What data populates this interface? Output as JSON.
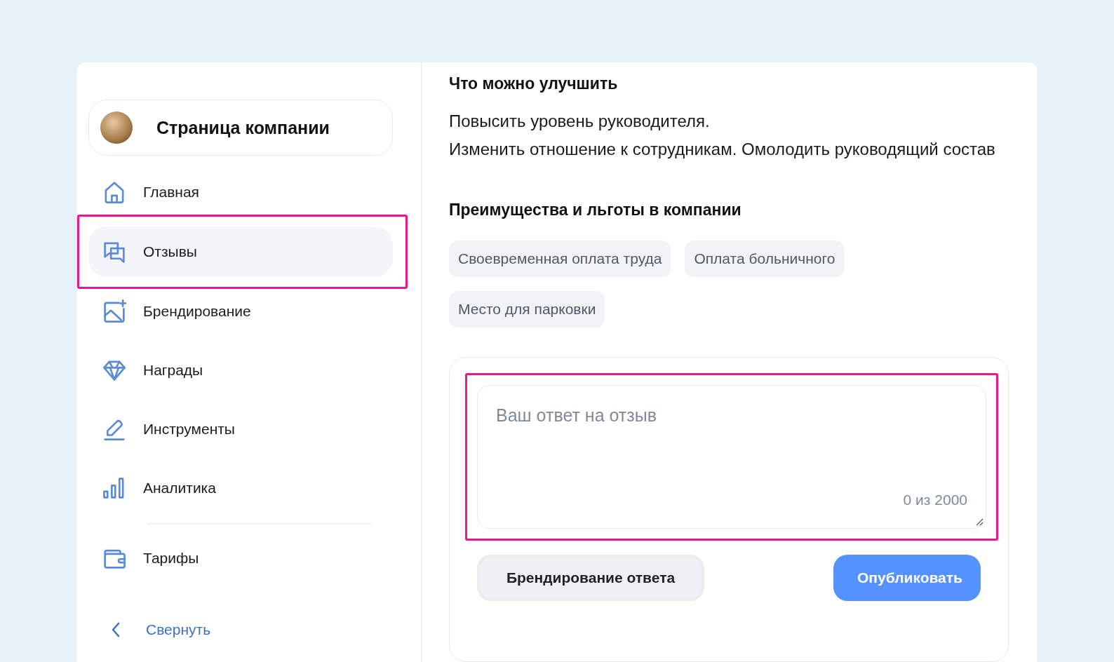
{
  "sidebar": {
    "company": {
      "name": "Страница компании"
    },
    "items": [
      {
        "label": "Главная",
        "kind": "home",
        "selected": false,
        "highlighted": false,
        "divider_before": false
      },
      {
        "label": "Отзывы",
        "kind": "chat",
        "selected": true,
        "highlighted": true,
        "divider_before": false
      },
      {
        "label": "Брендирование",
        "kind": "image",
        "selected": false,
        "highlighted": false,
        "divider_before": false
      },
      {
        "label": "Награды",
        "kind": "diamond",
        "selected": false,
        "highlighted": false,
        "divider_before": false
      },
      {
        "label": "Инструменты",
        "kind": "pencil",
        "selected": false,
        "highlighted": false,
        "divider_before": false
      },
      {
        "label": "Аналитика",
        "kind": "chart",
        "selected": false,
        "highlighted": false,
        "divider_before": false
      },
      {
        "label": "Тарифы",
        "kind": "wallet",
        "selected": false,
        "highlighted": false,
        "divider_before": true
      }
    ],
    "collapse": {
      "label": "Свернуть"
    }
  },
  "improve": {
    "title": "Что можно улучшить",
    "paragraphs": [
      "Повысить уровень руководителя.",
      "Изменить отношение к сотрудникам. Омолодить руководящий состав"
    ]
  },
  "benefits": {
    "title": "Преимущества и льготы в компании",
    "tags": [
      "Своевременная оплата труда",
      "Оплата больничного",
      "Место для парковки"
    ]
  },
  "reply": {
    "placeholder": "Ваш ответ на отзыв",
    "counter": "0 из 2000",
    "highlighted": true,
    "buttons": [
      {
        "label": "Брендирование ответа",
        "kind": "secondary"
      },
      {
        "label": "Опубликовать",
        "kind": "primary"
      }
    ]
  }
}
